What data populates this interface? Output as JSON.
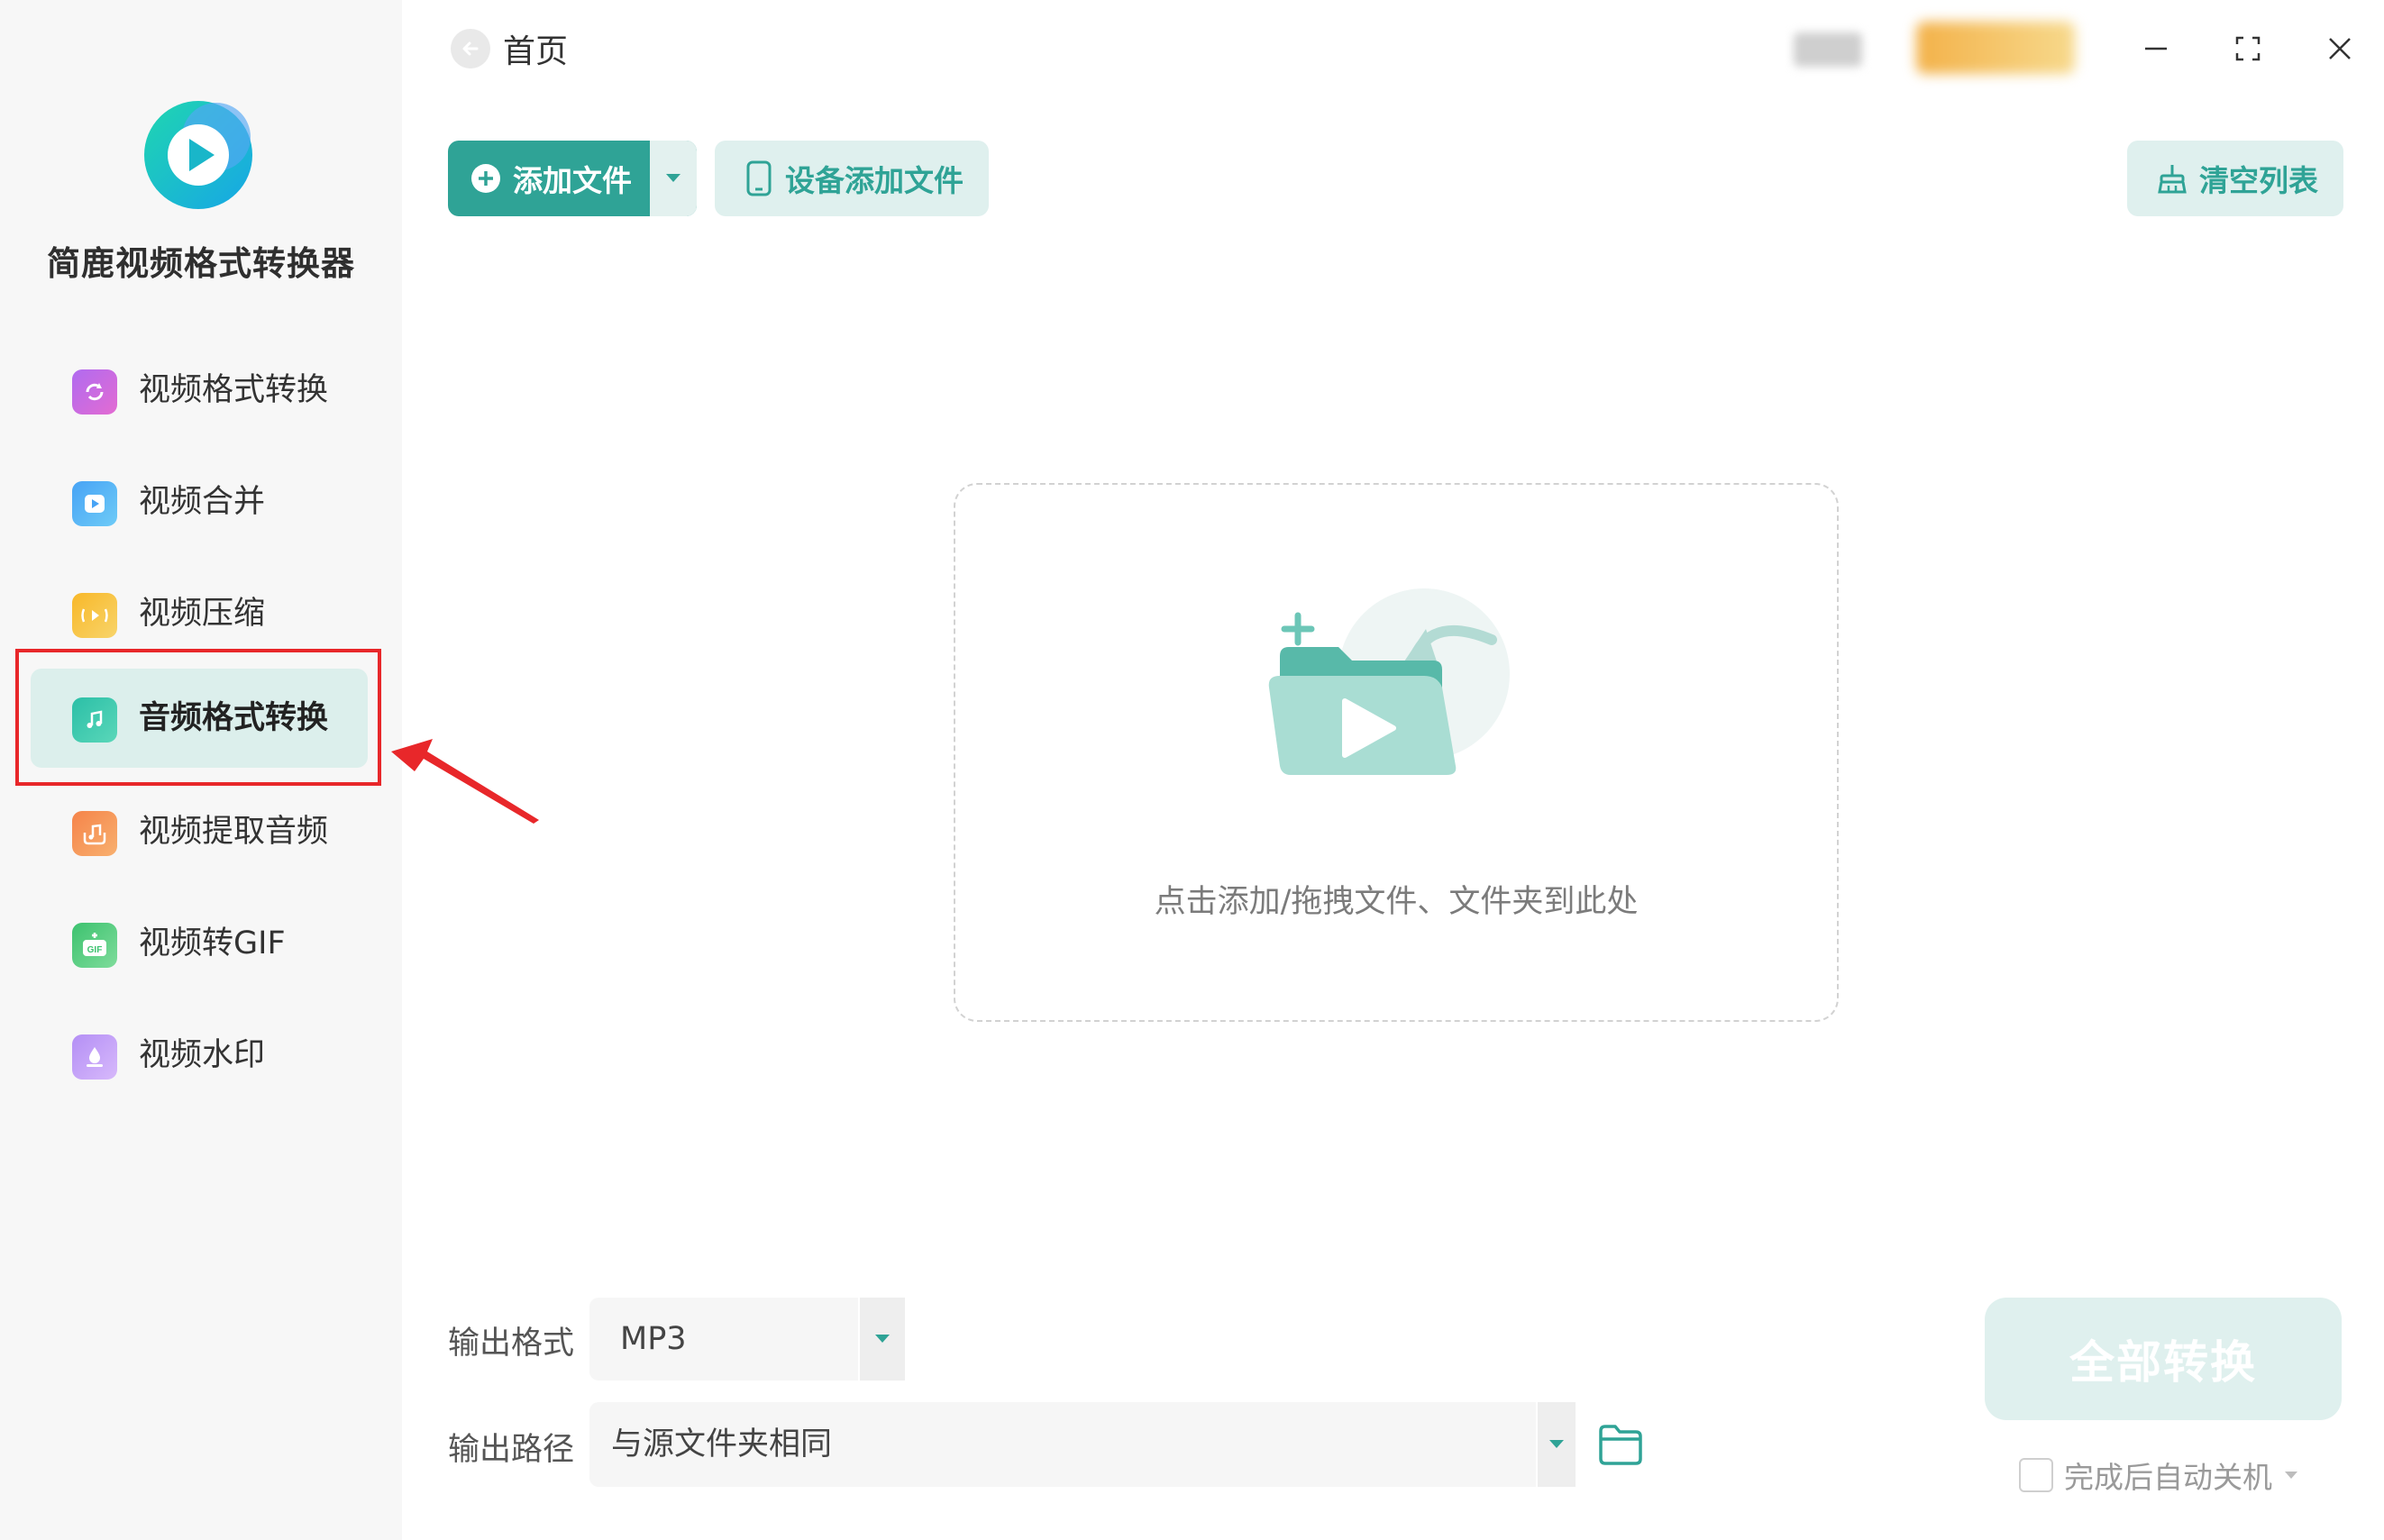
{
  "app": {
    "name": "简鹿视频格式转换器",
    "accent_color": "#2fa396",
    "light_accent_color": "#dff0ee"
  },
  "sidebar": {
    "items": [
      {
        "label": "视频格式转换",
        "icon": "video-convert-icon",
        "active": false
      },
      {
        "label": "视频合并",
        "icon": "video-merge-icon",
        "active": false
      },
      {
        "label": "视频压缩",
        "icon": "video-compress-icon",
        "active": false
      },
      {
        "label": "音频格式转换",
        "icon": "audio-convert-icon",
        "active": true
      },
      {
        "label": "视频提取音频",
        "icon": "extract-audio-icon",
        "active": false
      },
      {
        "label": "视频转GIF",
        "icon": "video-to-gif-icon",
        "active": false
      },
      {
        "label": "视频水印",
        "icon": "video-watermark-icon",
        "active": false
      }
    ]
  },
  "header": {
    "back_label": "首页"
  },
  "toolbar": {
    "add_file_label": "添加文件",
    "device_add_label": "设备添加文件",
    "clear_list_label": "清空列表"
  },
  "drop_zone": {
    "hint": "点击添加/拖拽文件、文件夹到此处"
  },
  "output": {
    "format_label": "输出格式",
    "format_value": "MP3",
    "path_label": "输出路径",
    "path_value": "与源文件夹相同"
  },
  "actions": {
    "convert_all_label": "全部转换",
    "shutdown_label": "完成后自动关机",
    "shutdown_checked": false
  }
}
